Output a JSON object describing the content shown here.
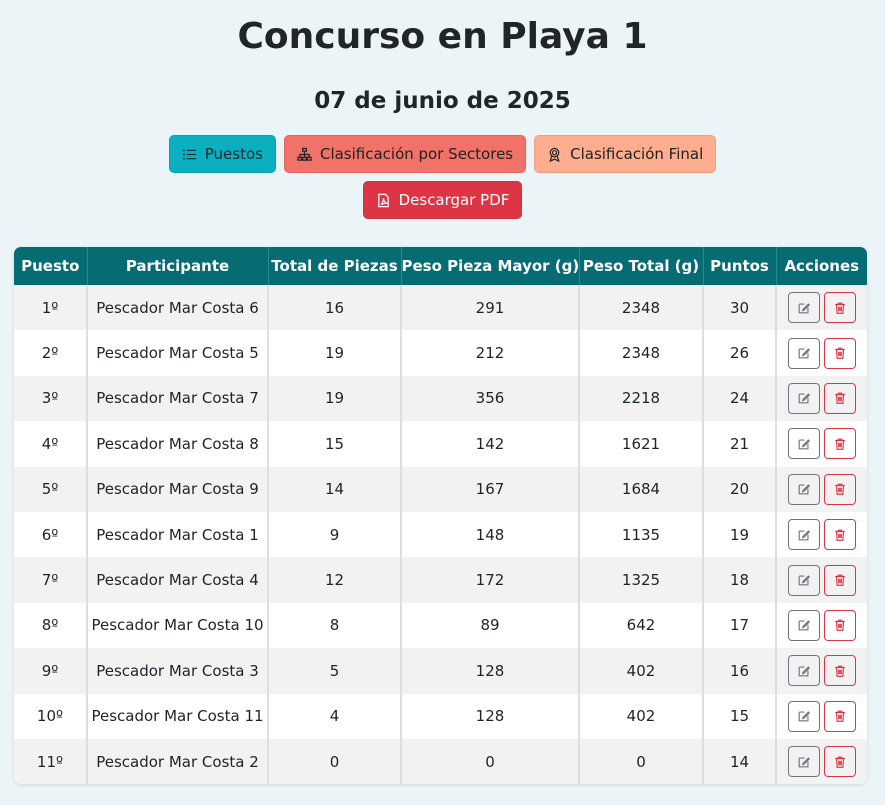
{
  "title": "Concurso en Playa 1",
  "date": "07 de junio de 2025",
  "buttons": {
    "puestos": "Puestos",
    "sectores": "Clasificación por Sectores",
    "final": "Clasificación Final",
    "pdf": "Descargar PDF"
  },
  "colors": {
    "header_bg": "#066c73",
    "puestos": "#0aafc0",
    "sectores": "#f07268",
    "final": "#ffad8f",
    "pdf": "#dc3545",
    "background": "#ebf4f7"
  },
  "table": {
    "headers": [
      "Puesto",
      "Participante",
      "Total de Piezas",
      "Peso Pieza Mayor (g)",
      "Peso Total (g)",
      "Puntos",
      "Acciones"
    ],
    "rows": [
      {
        "puesto": "1º",
        "participante": "Pescador Mar Costa 6",
        "piezas": "16",
        "mayor": "291",
        "total": "2348",
        "puntos": "30"
      },
      {
        "puesto": "2º",
        "participante": "Pescador Mar Costa 5",
        "piezas": "19",
        "mayor": "212",
        "total": "2348",
        "puntos": "26"
      },
      {
        "puesto": "3º",
        "participante": "Pescador Mar Costa 7",
        "piezas": "19",
        "mayor": "356",
        "total": "2218",
        "puntos": "24"
      },
      {
        "puesto": "4º",
        "participante": "Pescador Mar Costa 8",
        "piezas": "15",
        "mayor": "142",
        "total": "1621",
        "puntos": "21"
      },
      {
        "puesto": "5º",
        "participante": "Pescador Mar Costa 9",
        "piezas": "14",
        "mayor": "167",
        "total": "1684",
        "puntos": "20"
      },
      {
        "puesto": "6º",
        "participante": "Pescador Mar Costa 1",
        "piezas": "9",
        "mayor": "148",
        "total": "1135",
        "puntos": "19"
      },
      {
        "puesto": "7º",
        "participante": "Pescador Mar Costa 4",
        "piezas": "12",
        "mayor": "172",
        "total": "1325",
        "puntos": "18"
      },
      {
        "puesto": "8º",
        "participante": "Pescador Mar Costa 10",
        "piezas": "8",
        "mayor": "89",
        "total": "642",
        "puntos": "17"
      },
      {
        "puesto": "9º",
        "participante": "Pescador Mar Costa 3",
        "piezas": "5",
        "mayor": "128",
        "total": "402",
        "puntos": "16"
      },
      {
        "puesto": "10º",
        "participante": "Pescador Mar Costa 11",
        "piezas": "4",
        "mayor": "128",
        "total": "402",
        "puntos": "15"
      },
      {
        "puesto": "11º",
        "participante": "Pescador Mar Costa 2",
        "piezas": "0",
        "mayor": "0",
        "total": "0",
        "puntos": "14"
      }
    ]
  }
}
